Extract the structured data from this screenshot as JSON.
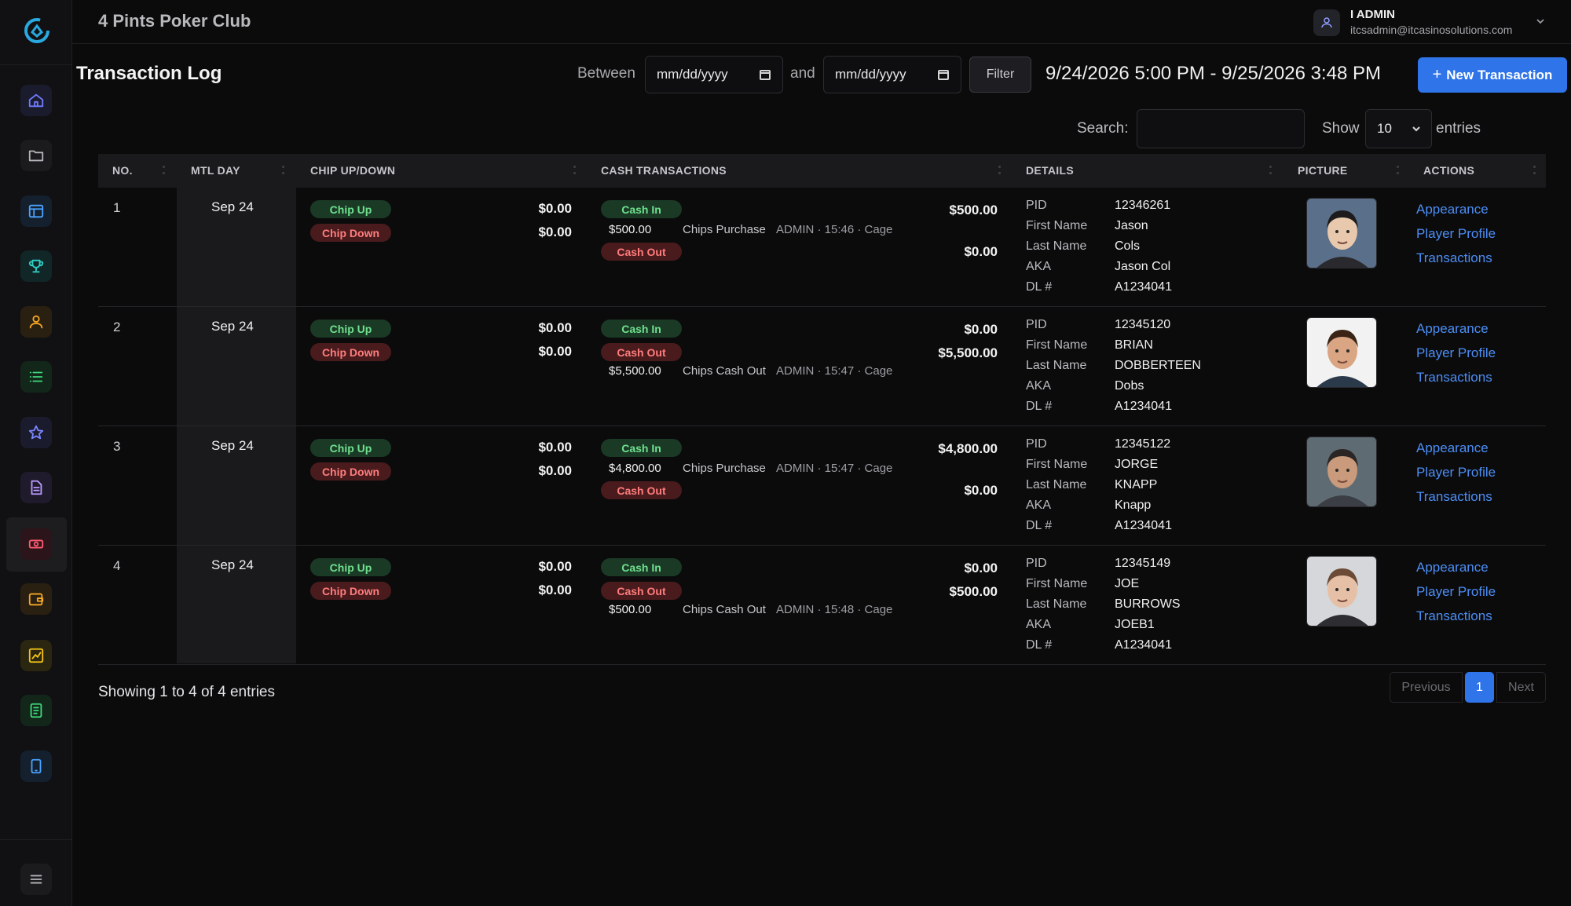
{
  "app": {
    "club_name": "4 Pints Poker Club"
  },
  "user": {
    "name": "I ADMIN",
    "email": "itcsadmin@itcasinosolutions.com"
  },
  "sidebar": {
    "items": [
      {
        "icon": "home-icon",
        "color": "#6f7dff"
      },
      {
        "icon": "folder-icon",
        "color": "#b5b5bb"
      },
      {
        "icon": "layout-icon",
        "color": "#4aa3ff"
      },
      {
        "icon": "trophy-icon",
        "color": "#2fd1c6"
      },
      {
        "icon": "user-icon",
        "color": "#f5a623"
      },
      {
        "icon": "list-icon",
        "color": "#3fd97a"
      },
      {
        "icon": "star-icon",
        "color": "#7b86ff"
      },
      {
        "icon": "document-icon",
        "color": "#b99cff"
      },
      {
        "icon": "money-icon",
        "color": "#ff5a6e"
      },
      {
        "icon": "wallet-icon",
        "color": "#f5a623"
      },
      {
        "icon": "chart-icon",
        "color": "#f5c518"
      },
      {
        "icon": "report-icon",
        "color": "#3fd97a"
      },
      {
        "icon": "tablet-icon",
        "color": "#4aa3ff"
      }
    ],
    "active_index": 8
  },
  "page": {
    "title": "Transaction Log",
    "between_label": "Between",
    "and_label": "and",
    "date_from_placeholder": "mm/dd/yyyy",
    "date_to_placeholder": "mm/dd/yyyy",
    "filter_label": "Filter",
    "range_text": "9/24/2026 5:00 PM - 9/25/2026 3:48 PM",
    "new_transaction_label": "New Transaction",
    "search_label": "Search:",
    "show_label": "Show",
    "show_value": "10",
    "entries_label": "entries"
  },
  "table": {
    "columns": [
      "NO.",
      "MTL DAY",
      "CHIP UP/DOWN",
      "CASH TRANSACTIONS",
      "DETAILS",
      "PICTURE",
      "ACTIONS"
    ],
    "chip_up_label": "Chip Up",
    "chip_down_label": "Chip Down",
    "cash_in_label": "Cash In",
    "cash_out_label": "Cash Out",
    "detail_keys": [
      "PID",
      "First Name",
      "Last Name",
      "AKA",
      "DL #"
    ],
    "actions": [
      "Appearance",
      "Player Profile",
      "Transactions"
    ],
    "rows": [
      {
        "no": "1",
        "day": "Sep 24",
        "chip_up": "$0.00",
        "chip_down": "$0.00",
        "cash_in_total": "$500.00",
        "cash_out_total": "$0.00",
        "txn_amount": "$500.00",
        "txn_type": "Chips Purchase",
        "txn_meta": "ADMIN · 15:46 · Cage",
        "pid": "12346261",
        "first_name": "Jason",
        "last_name": "Cols",
        "aka": "Jason Col",
        "dl": "A1234041"
      },
      {
        "no": "2",
        "day": "Sep 24",
        "chip_up": "$0.00",
        "chip_down": "$0.00",
        "cash_in_total": "$0.00",
        "cash_out_total": "$5,500.00",
        "txn_amount": "$5,500.00",
        "txn_type": "Chips Cash Out",
        "txn_meta": "ADMIN · 15:47 · Cage",
        "pid": "12345120",
        "first_name": "BRIAN",
        "last_name": "DOBBERTEEN",
        "aka": "Dobs",
        "dl": "A1234041"
      },
      {
        "no": "3",
        "day": "Sep 24",
        "chip_up": "$0.00",
        "chip_down": "$0.00",
        "cash_in_total": "$4,800.00",
        "cash_out_total": "$0.00",
        "txn_amount": "$4,800.00",
        "txn_type": "Chips Purchase",
        "txn_meta": "ADMIN · 15:47 · Cage",
        "pid": "12345122",
        "first_name": "JORGE",
        "last_name": "KNAPP",
        "aka": "Knapp",
        "dl": "A1234041"
      },
      {
        "no": "4",
        "day": "Sep 24",
        "chip_up": "$0.00",
        "chip_down": "$0.00",
        "cash_in_total": "$0.00",
        "cash_out_total": "$500.00",
        "txn_amount": "$500.00",
        "txn_type": "Chips Cash Out",
        "txn_meta": "ADMIN · 15:48 · Cage",
        "pid": "12345149",
        "first_name": "JOE",
        "last_name": "BURROWS",
        "aka": "JOEB1",
        "dl": "A1234041"
      }
    ]
  },
  "footer": {
    "showing_text": "Showing 1 to 4 of 4 entries",
    "prev_label": "Previous",
    "page_1": "1",
    "next_label": "Next"
  }
}
